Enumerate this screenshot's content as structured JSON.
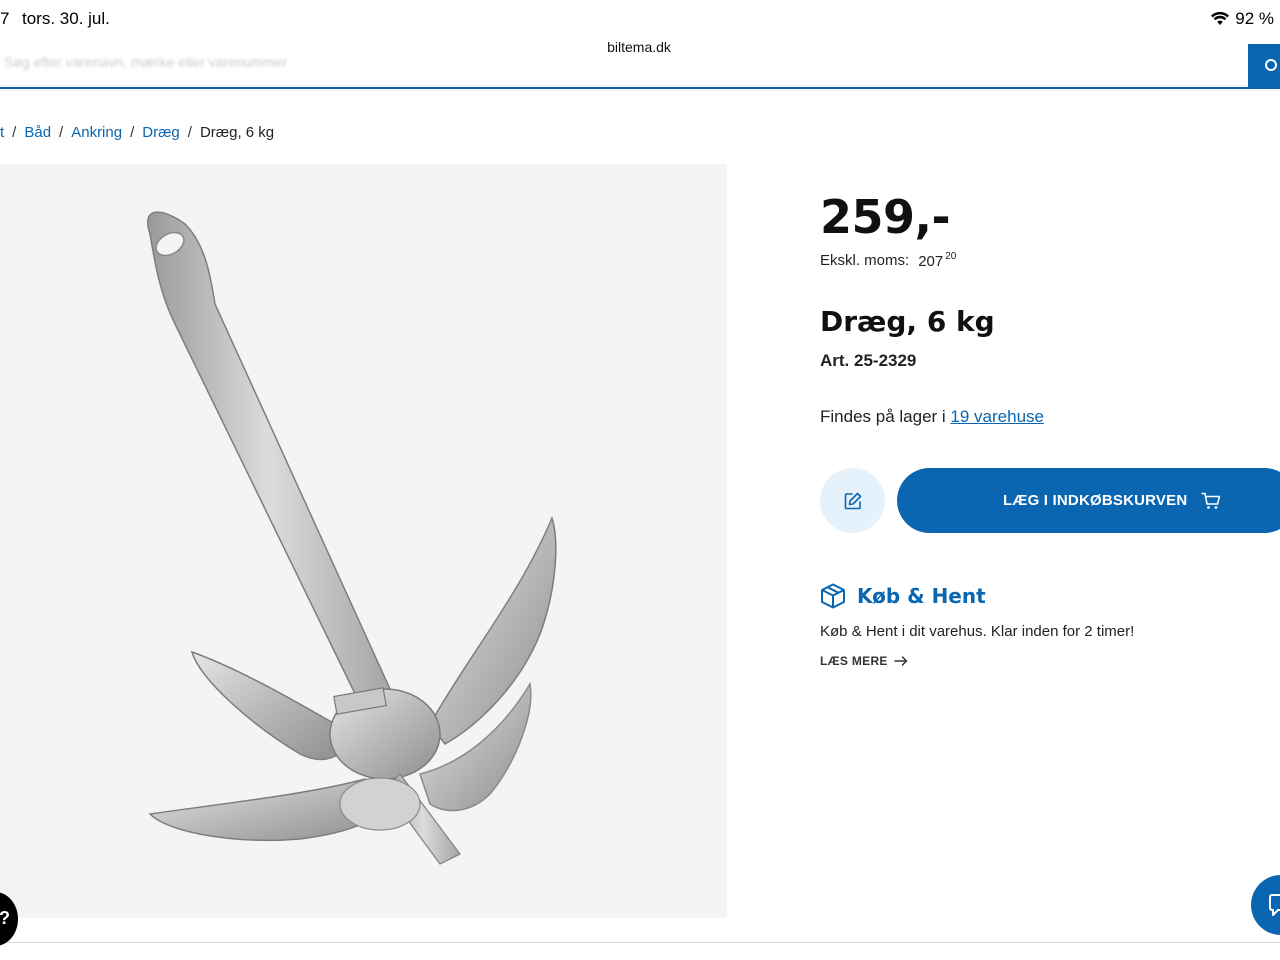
{
  "status_bar": {
    "time": "7",
    "date": "tors. 30. jul.",
    "battery": "92 %"
  },
  "browser": {
    "url": "biltema.dk"
  },
  "search": {
    "placeholder": "Søg efter varenavn, mærke eller varenummer"
  },
  "breadcrumb": {
    "items": [
      "t",
      "Båd",
      "Ankring",
      "Dræg"
    ],
    "current": "Dræg, 6 kg"
  },
  "product": {
    "price": "259,-",
    "ex_vat_label": "Ekskl. moms:",
    "ex_vat_value": "207",
    "ex_vat_decimals": "20",
    "title": "Dræg, 6 kg",
    "art_number": "Art. 25-2329",
    "stock_text": "Findes på lager i",
    "stock_link": "19 varehuse",
    "add_to_cart_label": "LÆG I INDKØBSKURVEN"
  },
  "koeb_hent": {
    "title": "Køb & Hent",
    "text": "Køb & Hent i dit varehus. Klar inden for 2 timer!",
    "read_more": "LÆS MERE"
  },
  "colors": {
    "brand": "#0a66b0",
    "light_brand": "#e5f1fb",
    "image_bg": "#f4f4f4"
  },
  "icons": [
    "wifi-icon",
    "search-icon",
    "edit-note-icon",
    "cart-icon",
    "package-icon",
    "arrow-right-icon",
    "chat-icon"
  ]
}
